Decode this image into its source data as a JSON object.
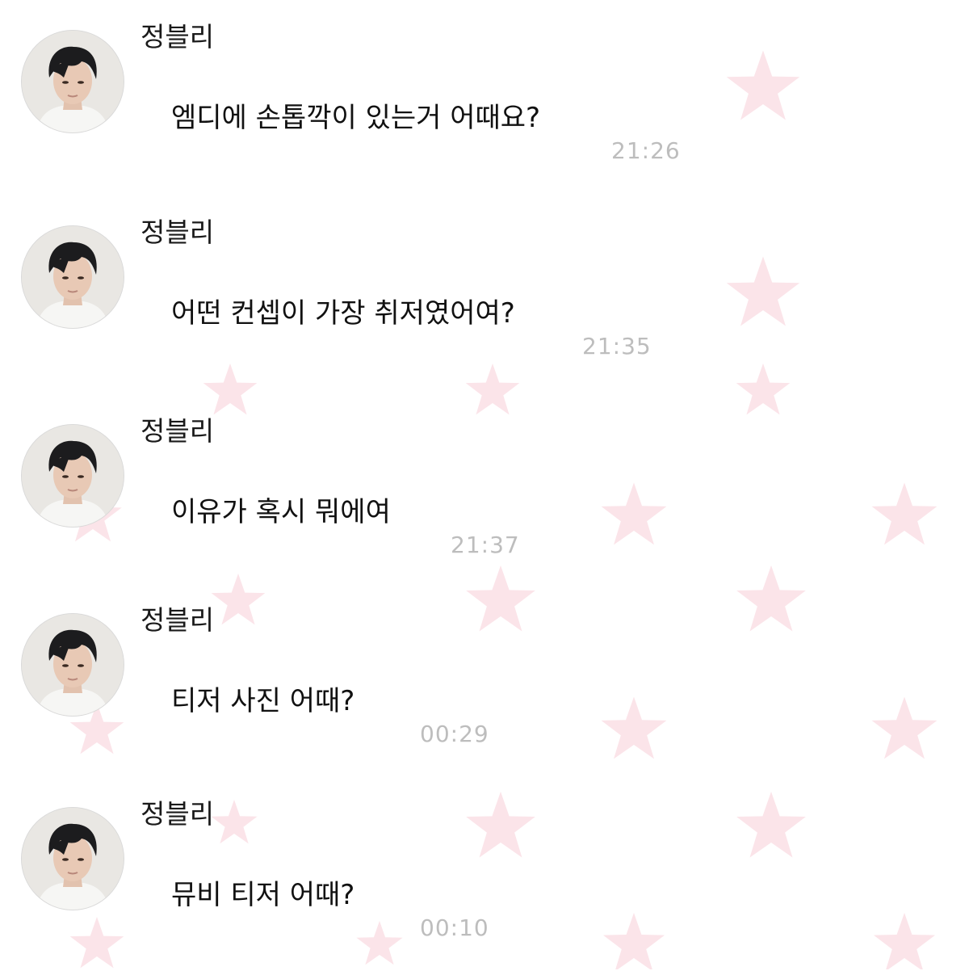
{
  "background": {
    "color": "#ffffff",
    "star_color": "#fbe3e8"
  },
  "messages": [
    {
      "sender": "정블리",
      "avatar": "profile-photo",
      "text": "엠디에 손톱깍이 있는거 어때요?",
      "time": "21:26"
    },
    {
      "sender": "정블리",
      "avatar": "profile-photo",
      "text": "어떤 컨셉이 가장 취저였어여?",
      "time": "21:35"
    },
    {
      "sender": "정블리",
      "avatar": "profile-photo",
      "text": "이유가 혹시 뭐에여",
      "time": "21:37"
    },
    {
      "sender": "정블리",
      "avatar": "profile-photo",
      "text": "티저 사진 어때?",
      "time": "00:29"
    },
    {
      "sender": "정블리",
      "avatar": "profile-photo",
      "text": "뮤비 티저 어때?",
      "time": "00:10"
    }
  ]
}
